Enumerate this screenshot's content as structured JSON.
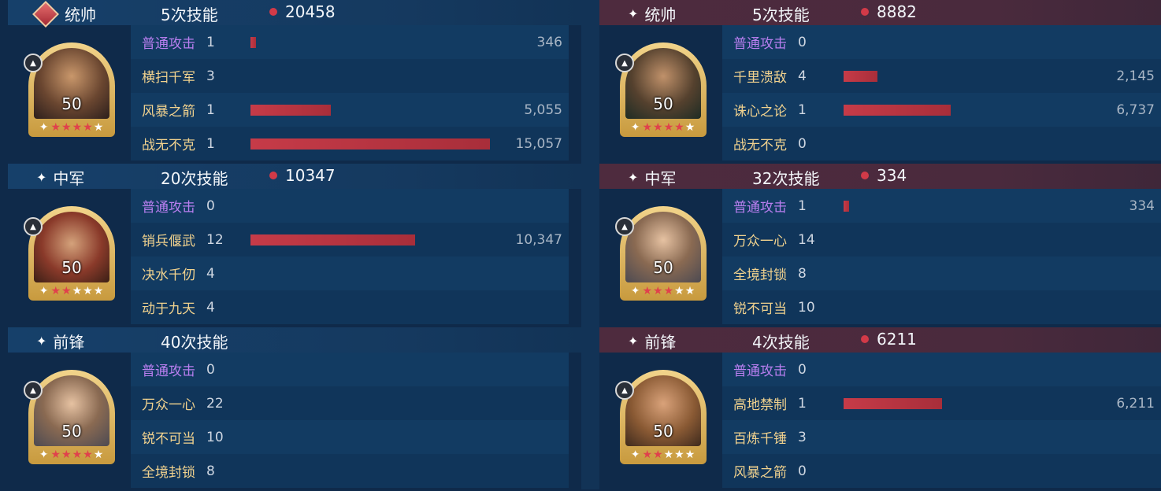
{
  "colors": {
    "bar": "#c63b48",
    "basic_attack": "#b97ff0",
    "skill": "#f1d28e",
    "left_header": "#16406a",
    "right_header": "#4e2b3e"
  },
  "left": [
    {
      "position": "统帅",
      "skill_count": "5次技能",
      "damage": "20458",
      "level": "50",
      "stars": 6,
      "red_stars": 4,
      "portrait": "c1",
      "skills": [
        {
          "name": "普通攻击",
          "times": "1",
          "value": "346",
          "bar": 346,
          "basic": true
        },
        {
          "name": "横扫千军",
          "times": "3",
          "value": "",
          "bar": 0
        },
        {
          "name": "风暴之箭",
          "times": "1",
          "value": "5,055",
          "bar": 5055
        },
        {
          "name": "战无不克",
          "times": "1",
          "value": "15,057",
          "bar": 15057
        }
      ]
    },
    {
      "position": "中军",
      "skill_count": "20次技能",
      "damage": "10347",
      "level": "50",
      "stars": 5,
      "red_stars": 2,
      "portrait": "c3",
      "skills": [
        {
          "name": "普通攻击",
          "times": "0",
          "value": "",
          "bar": 0,
          "basic": true
        },
        {
          "name": "销兵偃武",
          "times": "12",
          "value": "10,347",
          "bar": 10347
        },
        {
          "name": "决水千仞",
          "times": "4",
          "value": "",
          "bar": 0
        },
        {
          "name": "动于九天",
          "times": "4",
          "value": "",
          "bar": 0
        }
      ]
    },
    {
      "position": "前锋",
      "skill_count": "40次技能",
      "damage": "",
      "level": "50",
      "stars": 5,
      "red_stars": 4,
      "portrait": "c4",
      "skills": [
        {
          "name": "普通攻击",
          "times": "0",
          "value": "",
          "bar": 0,
          "basic": true
        },
        {
          "name": "万众一心",
          "times": "22",
          "value": "",
          "bar": 0
        },
        {
          "name": "锐不可当",
          "times": "10",
          "value": "",
          "bar": 0
        },
        {
          "name": "全境封锁",
          "times": "8",
          "value": "",
          "bar": 0
        }
      ]
    }
  ],
  "right": [
    {
      "position": "统帅",
      "skill_count": "5次技能",
      "damage": "8882",
      "level": "50",
      "stars": 5,
      "red_stars": 4,
      "portrait": "c2",
      "skills": [
        {
          "name": "普通攻击",
          "times": "0",
          "value": "",
          "bar": 0,
          "basic": true
        },
        {
          "name": "千里溃敌",
          "times": "4",
          "value": "2,145",
          "bar": 2145
        },
        {
          "name": "诛心之论",
          "times": "1",
          "value": "6,737",
          "bar": 6737
        },
        {
          "name": "战无不克",
          "times": "0",
          "value": "",
          "bar": 0
        }
      ]
    },
    {
      "position": "中军",
      "skill_count": "32次技能",
      "damage": "334",
      "level": "50",
      "stars": 5,
      "red_stars": 3,
      "portrait": "c4",
      "skills": [
        {
          "name": "普通攻击",
          "times": "1",
          "value": "334",
          "bar": 334,
          "basic": true
        },
        {
          "name": "万众一心",
          "times": "14",
          "value": "",
          "bar": 0
        },
        {
          "name": "全境封锁",
          "times": "8",
          "value": "",
          "bar": 0
        },
        {
          "name": "锐不可当",
          "times": "10",
          "value": "",
          "bar": 0
        }
      ]
    },
    {
      "position": "前锋",
      "skill_count": "4次技能",
      "damage": "6211",
      "level": "50",
      "stars": 5,
      "red_stars": 2,
      "portrait": "c5",
      "skills": [
        {
          "name": "普通攻击",
          "times": "0",
          "value": "",
          "bar": 0,
          "basic": true
        },
        {
          "name": "高地禁制",
          "times": "1",
          "value": "6,211",
          "bar": 6211
        },
        {
          "name": "百炼千锤",
          "times": "3",
          "value": "",
          "bar": 0
        },
        {
          "name": "风暴之箭",
          "times": "0",
          "value": "",
          "bar": 0
        }
      ]
    }
  ]
}
